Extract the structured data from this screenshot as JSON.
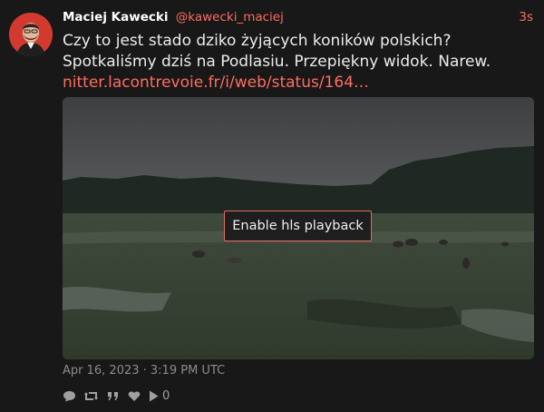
{
  "tweet": {
    "author_name": "Maciej Kawecki",
    "author_handle": "@kawecki_maciej",
    "time_ago": "3s",
    "text": "Czy to jest stado dziko żyjących koników polskich? Spotkaliśmy dziś na Podlasiu. Przepiękny widok. Narew.",
    "link_text": "nitter.lacontrevoie.fr/i/web/status/164…",
    "date": "Apr 16, 2023 · 3:19 PM UTC"
  },
  "media": {
    "button_label": "Enable hls playback"
  },
  "stats": {
    "icons": [
      "comment-icon",
      "retweet-icon",
      "quote-icon",
      "heart-icon",
      "play-icon"
    ],
    "play_count": "0"
  },
  "colors": {
    "accent": "#ff6c60",
    "background": "#181818",
    "text": "#e8e8e8",
    "muted": "#8c8c8c"
  }
}
